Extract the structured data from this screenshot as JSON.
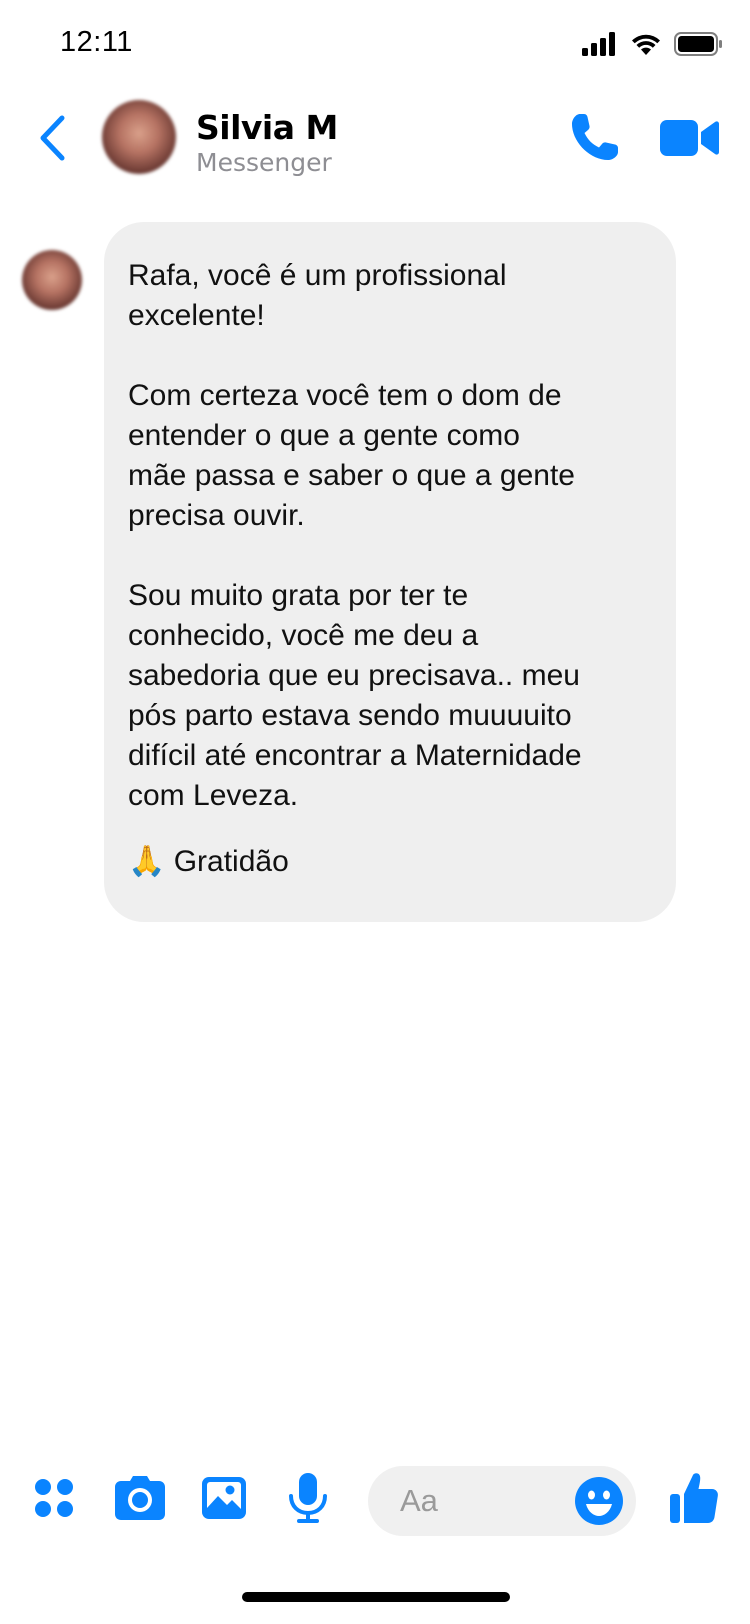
{
  "status_bar": {
    "time": "12:11",
    "icons": [
      "signal-icon",
      "wifi-icon",
      "battery-icon"
    ]
  },
  "header": {
    "back_icon": "chevron-left-icon",
    "contact_name": "Silvia M",
    "contact_subtitle": "Messenger",
    "actions": [
      "phone-icon",
      "video-camera-icon"
    ]
  },
  "message": {
    "paragraphs": [
      "Rafa, você é um profissional\nexcelente!",
      "Com certeza você tem o dom de\nentender o que a gente como\nmãe passa e saber o que a gente\nprecisa ouvir.",
      "Sou muito grata por ter te\nconhecido, você me deu a\nsabedoria que eu precisava.. meu\npós parto estava sendo muuuuito\ndifícil até encontrar a Maternidade\ncom Leveza."
    ],
    "signoff": "🙏 Gratidão"
  },
  "toolbar": {
    "icons": [
      "apps-icon",
      "camera-icon",
      "image-icon",
      "microphone-icon",
      "emoji-icon",
      "thumbs-up-icon"
    ],
    "composer_placeholder": "Aa"
  },
  "colors": {
    "accent": "#0a84ff",
    "bubble": "#efefef",
    "subtitle": "#8e8e93"
  }
}
